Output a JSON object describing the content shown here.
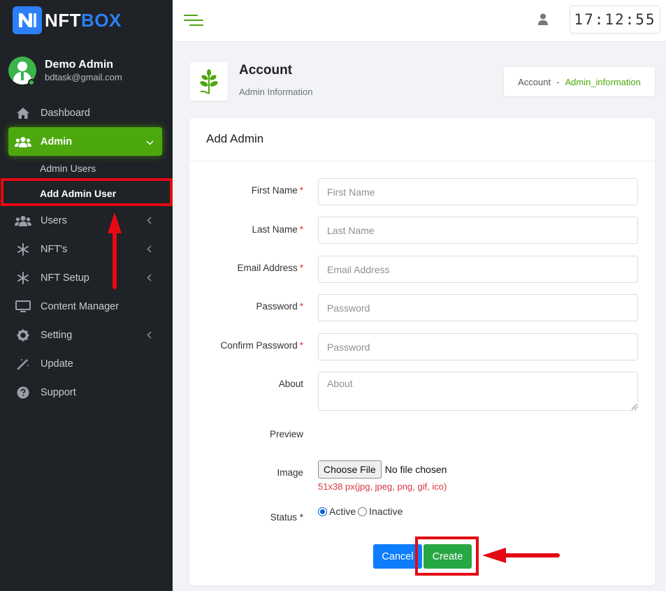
{
  "brand": {
    "part1": "NFT",
    "part2": "BOX"
  },
  "profile": {
    "name": "Demo Admin",
    "email": "bdtask@gmail.com"
  },
  "nav": {
    "dashboard": "Dashboard",
    "admin": "Admin",
    "admin_sub": [
      "Admin Users",
      "Add Admin User"
    ],
    "users": "Users",
    "nfts": "NFT's",
    "nft_setup": "NFT Setup",
    "content_manager": "Content Manager",
    "setting": "Setting",
    "update": "Update",
    "support": "Support"
  },
  "topbar": {
    "clock": "17:12:55"
  },
  "page": {
    "title": "Account",
    "subtitle": "Admin Information"
  },
  "breadcrumb": {
    "root": "Account",
    "separator": "-",
    "current": "Admin_information"
  },
  "form": {
    "heading": "Add Admin",
    "first_name": {
      "label": "First Name",
      "placeholder": "First Name"
    },
    "last_name": {
      "label": "Last Name",
      "placeholder": "Last Name"
    },
    "email": {
      "label": "Email Address",
      "placeholder": "Email Address"
    },
    "password": {
      "label": "Password",
      "placeholder": "Password"
    },
    "confirm_password": {
      "label": "Confirm Password",
      "placeholder": "Password"
    },
    "about": {
      "label": "About",
      "placeholder": "About"
    },
    "preview": {
      "label": "Preview"
    },
    "image": {
      "label": "Image",
      "button": "Choose File",
      "status": "No file chosen",
      "hint": "51x38 px(jpg, jpeg, png, gif, ico)"
    },
    "status": {
      "label": "Status *",
      "options": [
        "Active",
        "Inactive"
      ],
      "selected": "Active"
    },
    "required_mark": "*",
    "cancel": "Cancel",
    "create": "Create"
  },
  "colors": {
    "accent": "#4ca80e",
    "sidebar_bg": "#1f2226",
    "primary": "#0d7dfd",
    "success": "#28a745",
    "highlight": "#e50914"
  }
}
